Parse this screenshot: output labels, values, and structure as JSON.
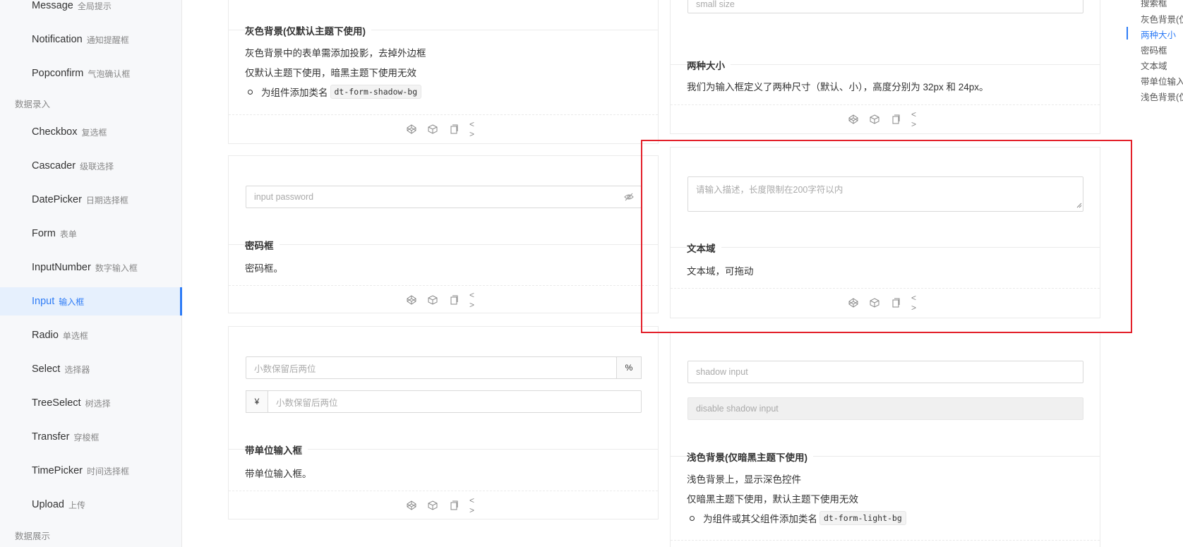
{
  "sidebar": {
    "items": [
      {
        "en": "Message",
        "cn": "全局提示"
      },
      {
        "en": "Notification",
        "cn": "通知提醒框"
      },
      {
        "en": "Popconfirm",
        "cn": "气泡确认框"
      },
      {
        "en": "Checkbox",
        "cn": "复选框"
      },
      {
        "en": "Cascader",
        "cn": "级联选择"
      },
      {
        "en": "DatePicker",
        "cn": "日期选择框"
      },
      {
        "en": "Form",
        "cn": "表单"
      },
      {
        "en": "InputNumber",
        "cn": "数字输入框"
      },
      {
        "en": "Input",
        "cn": "输入框"
      },
      {
        "en": "Radio",
        "cn": "单选框"
      },
      {
        "en": "Select",
        "cn": "选择器"
      },
      {
        "en": "TreeSelect",
        "cn": "树选择"
      },
      {
        "en": "Transfer",
        "cn": "穿梭框"
      },
      {
        "en": "TimePicker",
        "cn": "时间选择框"
      },
      {
        "en": "Upload",
        "cn": "上传"
      }
    ],
    "groups": {
      "data_entry": "数据录入",
      "data_display": "数据展示"
    },
    "active": "Input"
  },
  "left_col": {
    "gray_bg": {
      "title": "灰色背景(仅默认主题下使用)",
      "desc1": "灰色背景中的表单需添加投影，去掉外边框",
      "desc2": "仅默认主题下使用，暗黑主题下使用无效",
      "bullet": "为组件添加类名",
      "code": "dt-form-shadow-bg"
    },
    "password": {
      "placeholder": "input password",
      "title": "密码框",
      "desc": "密码框。"
    },
    "unit": {
      "placeholder1": "小数保留后两位",
      "suffix": "%",
      "prefix": "¥",
      "placeholder2": "小数保留后两位",
      "title": "带单位输入框",
      "desc": "带单位输入框。"
    }
  },
  "right_col": {
    "sizes": {
      "small_placeholder": "small size",
      "title": "两种大小",
      "desc": "我们为输入框定义了两种尺寸（默认、小），高度分别为 32px 和 24px。"
    },
    "textarea": {
      "placeholder": "请输入描述，长度限制在200字符以内",
      "title": "文本域",
      "desc": "文本域，可拖动"
    },
    "light_bg": {
      "shadow_placeholder": "shadow input",
      "disabled_placeholder": "disable shadow input",
      "title": "浅色背景(仅暗黑主题下使用)",
      "desc1": "浅色背景上，显示深色控件",
      "desc2": "仅暗黑主题下使用，默认主题下使用无效",
      "bullet": "为组件或其父组件添加类名",
      "code": "dt-form-light-bg"
    }
  },
  "actions": {
    "codepen": "codepen-icon",
    "codesandbox": "codesandbox-icon",
    "copy": "copy-icon",
    "code": "code-icon",
    "code_glyph": "< >"
  },
  "toc": {
    "items": [
      "搜索框",
      "灰色背景(仅",
      "两种大小",
      "密码框",
      "文本域",
      "带单位输入",
      "浅色背景(仅"
    ],
    "active": "两种大小"
  },
  "colors": {
    "accent": "#2e7cf6",
    "highlight": "#e3202a"
  }
}
